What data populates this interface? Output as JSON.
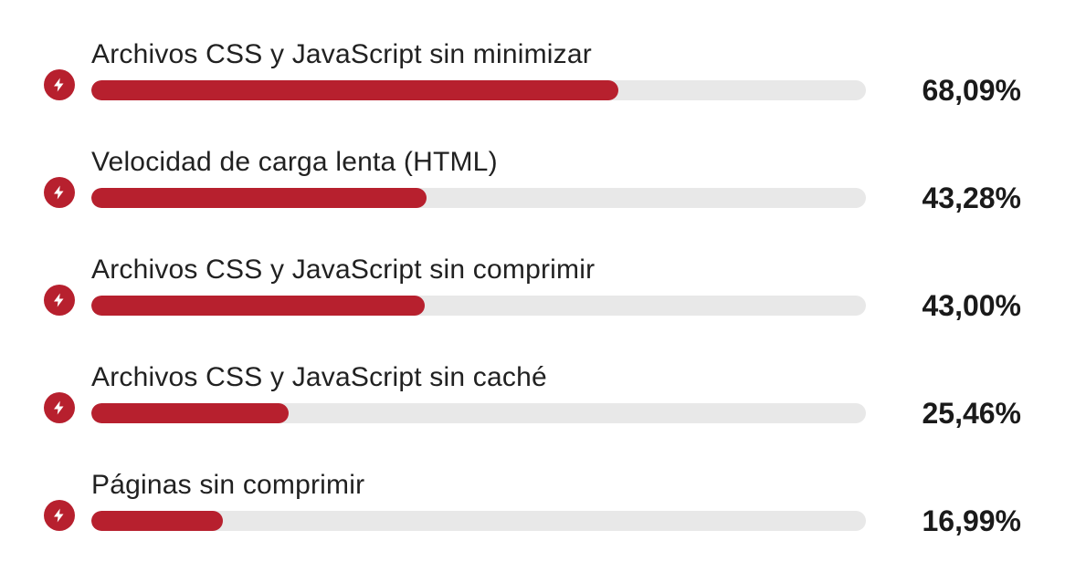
{
  "accent_color": "#b7202e",
  "track_color": "#e8e8e8",
  "chart_data": {
    "type": "bar",
    "orientation": "horizontal",
    "unit": "%",
    "locale": "es",
    "xlim": [
      0,
      100
    ],
    "categories": [
      "Archivos CSS y JavaScript sin minimizar",
      "Velocidad de carga lenta (HTML)",
      "Archivos CSS y JavaScript sin comprimir",
      "Archivos CSS y JavaScript sin caché",
      "Páginas sin comprimir"
    ],
    "values": [
      68.09,
      43.28,
      43.0,
      25.46,
      16.99
    ],
    "value_labels": [
      "68,09%",
      "43,28%",
      "43,00%",
      "25,46%",
      "16,99%"
    ],
    "icon": "bolt-icon"
  }
}
